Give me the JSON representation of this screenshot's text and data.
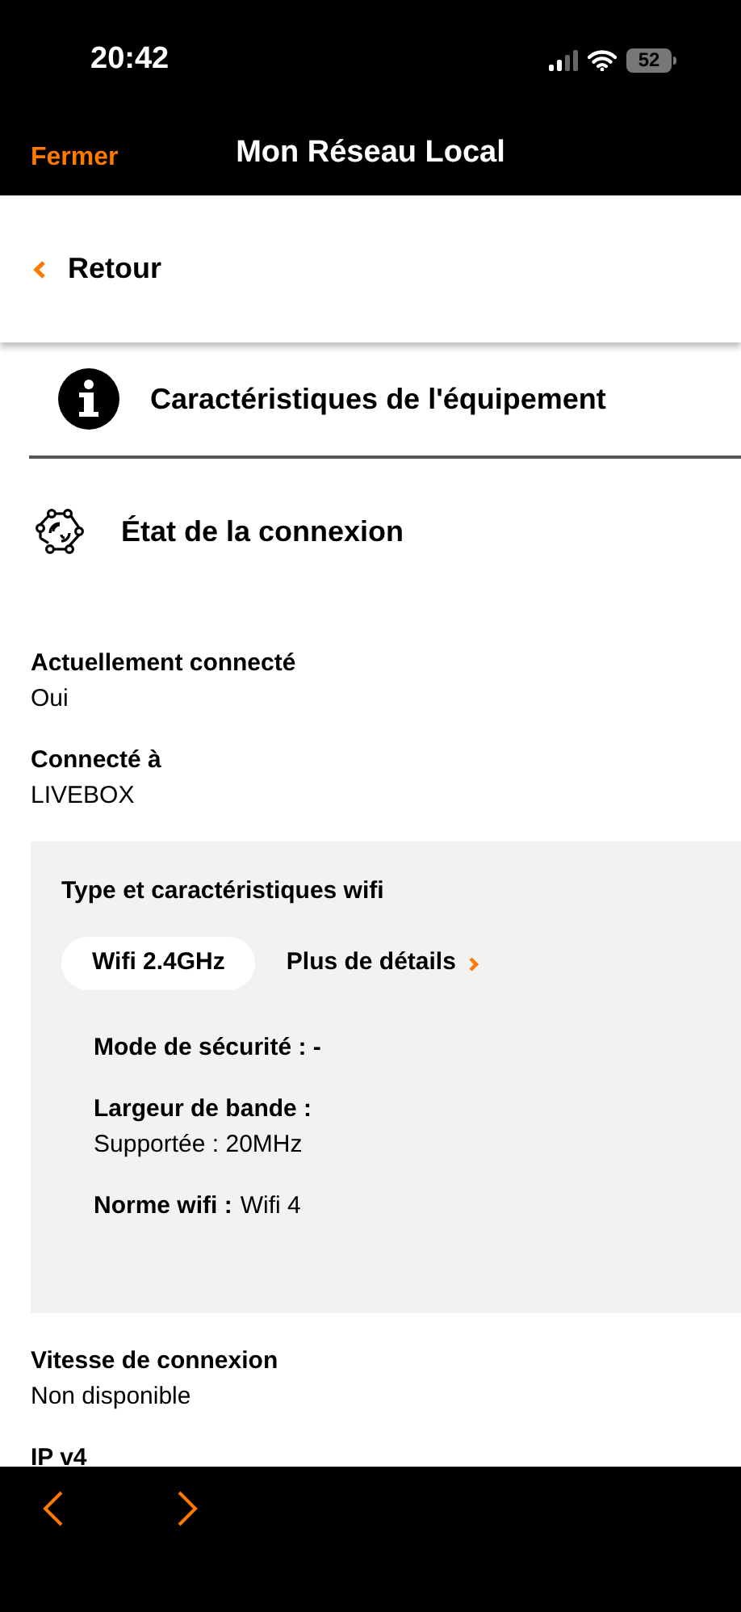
{
  "status_bar": {
    "time": "20:42",
    "battery": "52"
  },
  "nav_bar": {
    "close": "Fermer",
    "title": "Mon Réseau Local"
  },
  "back": {
    "label": "Retour"
  },
  "sections": [
    {
      "kind": "info",
      "label": "Caractéristiques de l'équipement"
    },
    {
      "kind": "connection",
      "label": "État de la connexion"
    }
  ],
  "fields": [
    {
      "label": "Actuellement connecté",
      "value": "Oui"
    },
    {
      "label": "Connecté à",
      "value": "LIVEBOX"
    }
  ],
  "wifi_card": {
    "title": "Type et caractéristiques wifi",
    "bands": [
      {
        "label": "Wifi 2.4GHz",
        "selected": true
      }
    ],
    "details_link": "Plus de détails",
    "items": [
      {
        "kind": "inline",
        "label": "Mode de sécurité : -"
      },
      {
        "kind": "stacked",
        "label": "Largeur de bande :",
        "value": "Supportée : 20MHz"
      },
      {
        "kind": "inline",
        "label": "Norme wifi :",
        "value": "Wifi 4"
      }
    ]
  },
  "fields_after": [
    {
      "label": "Vitesse de connexion",
      "value": "Non disponible"
    },
    {
      "label": "IP v4"
    }
  ]
}
